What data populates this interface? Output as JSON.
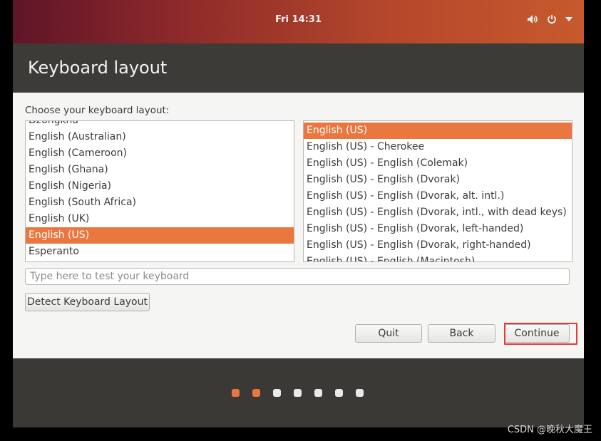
{
  "topbar": {
    "clock": "Fri 14:31",
    "icons": [
      "volume-icon",
      "power-icon",
      "dropdown-arrow-icon"
    ]
  },
  "window": {
    "title": "Keyboard layout"
  },
  "prompt": "Choose your keyboard layout:",
  "layouts": {
    "items": [
      "Dzongkha",
      "English (Australian)",
      "English (Cameroon)",
      "English (Ghana)",
      "English (Nigeria)",
      "English (South Africa)",
      "English (UK)",
      "English (US)",
      "Esperanto"
    ],
    "selected": "English (US)"
  },
  "variants": {
    "items": [
      "English (US)",
      "English (US) - Cherokee",
      "English (US) - English (Colemak)",
      "English (US) - English (Dvorak)",
      "English (US) - English (Dvorak, alt. intl.)",
      "English (US) - English (Dvorak, intl., with dead keys)",
      "English (US) - English (Dvorak, left-handed)",
      "English (US) - English (Dvorak, right-handed)",
      "English (US) - English (Macintosh)"
    ],
    "selected": "English (US)"
  },
  "test_input": {
    "placeholder": "Type here to test your keyboard",
    "value": ""
  },
  "buttons": {
    "detect": "Detect Keyboard Layout",
    "quit": "Quit",
    "back": "Back",
    "continue": "Continue"
  },
  "progress": {
    "total_steps": 7,
    "completed_steps": 2
  },
  "colors": {
    "accent": "#e9773f",
    "highlight_box": "#e53a3a"
  },
  "watermark": "CSDN @晚秋大魔王"
}
